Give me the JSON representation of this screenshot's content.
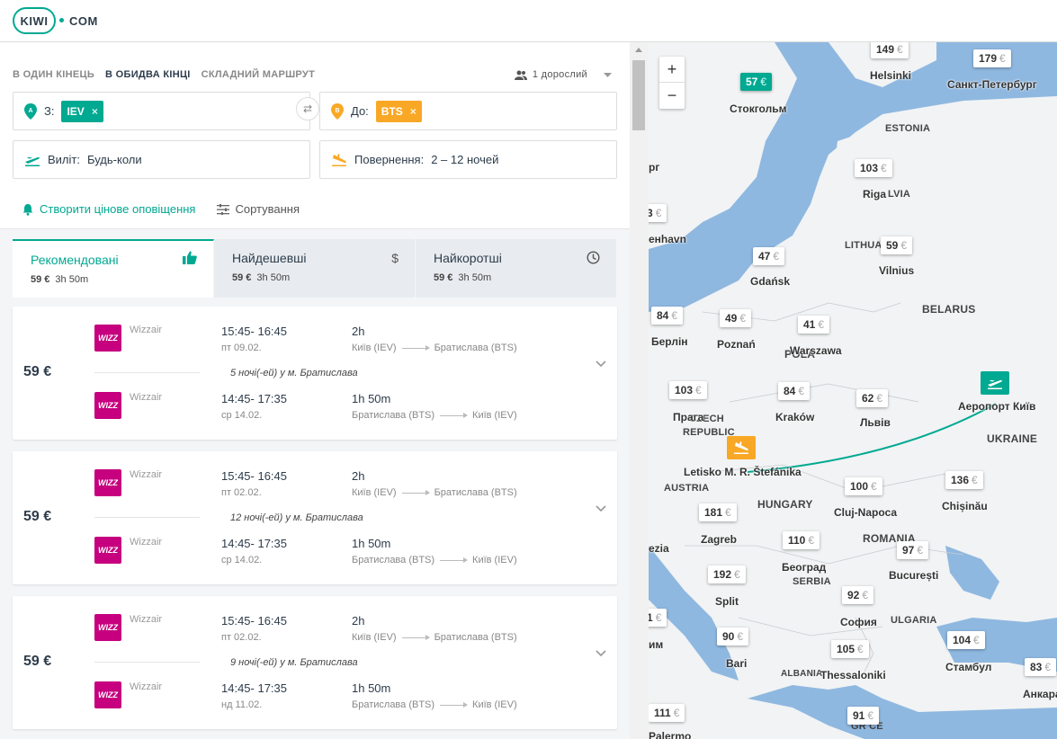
{
  "header": {
    "logo": "KIWI",
    "logo_rest": "COM"
  },
  "search": {
    "trip_types": [
      "В ОДИН КІНЕЦЬ",
      "В ОБИДВА КІНЦІ",
      "СКЛАДНИЙ МАРШРУТ"
    ],
    "passengers": "1 дорослий",
    "from_label": "З:",
    "from_value": "IEV",
    "to_label": "До:",
    "to_value": "BTS",
    "depart_label": "Виліт:",
    "depart_value": "Будь-коли",
    "return_label": "Повернення:",
    "return_value": "2 – 12 ночей",
    "chip_remove": "×",
    "swap": "⇄"
  },
  "actions": {
    "alert": "Створити цінове оповіщення",
    "sort": "Сортування"
  },
  "tabs": [
    {
      "title": "Рекомендовані",
      "price": "59 €",
      "duration": "3h 50m",
      "icon": "thumbs-up-icon"
    },
    {
      "title": "Найдешевші",
      "price": "59 €",
      "duration": "3h 50m",
      "icon": "dollar-icon"
    },
    {
      "title": "Найкоротші",
      "price": "59 €",
      "duration": "3h 50m",
      "icon": "clock-icon"
    }
  ],
  "results": [
    {
      "price": "59 €",
      "out": {
        "carrier": "Wizzair",
        "time": "15:45- 16:45",
        "date": "пт 09.02.",
        "duration": "2h",
        "from": "Київ (IEV)",
        "to": "Братислава (BTS)"
      },
      "stay": "5 ночі(-ей) у м. Братислава",
      "back": {
        "carrier": "Wizzair",
        "time": "14:45- 17:35",
        "date": "ср 14.02.",
        "duration": "1h 50m",
        "from": "Братислава (BTS)",
        "to": "Київ (IEV)"
      }
    },
    {
      "price": "59 €",
      "out": {
        "carrier": "Wizzair",
        "time": "15:45- 16:45",
        "date": "пт 02.02.",
        "duration": "2h",
        "from": "Київ (IEV)",
        "to": "Братислава (BTS)"
      },
      "stay": "12 ночі(-ей) у м. Братислава",
      "back": {
        "carrier": "Wizzair",
        "time": "14:45- 17:35",
        "date": "ср 14.02.",
        "duration": "1h 50m",
        "from": "Братислава (BTS)",
        "to": "Київ (IEV)"
      }
    },
    {
      "price": "59 €",
      "out": {
        "carrier": "Wizzair",
        "time": "15:45- 16:45",
        "date": "пт 02.02.",
        "duration": "2h",
        "from": "Київ (IEV)",
        "to": "Братислава (BTS)"
      },
      "stay": "9 ночі(-ей) у м. Братислава",
      "back": {
        "carrier": "Wizzair",
        "time": "14:45- 17:35",
        "date": "нд 11.02.",
        "duration": "1h 50m",
        "from": "Братислава (BTS)",
        "to": "Київ (IEV)"
      }
    }
  ],
  "wizz_logo": "WIZZ",
  "map": {
    "zoom_in": "+",
    "zoom_out": "−",
    "euro": "€",
    "prices": [
      "149",
      "179",
      "57",
      "103",
      "3",
      "47",
      "59",
      "84",
      "49",
      "41",
      "103",
      "84",
      "62",
      "181",
      "100",
      "136",
      "110",
      "97",
      "192",
      "92",
      "1",
      "90",
      "105",
      "104",
      "83",
      "111",
      "91"
    ],
    "cities": [
      "Helsinki",
      "Санкт-Петербург",
      "Стокгольм",
      "Riga",
      "Vilnius",
      "Gdańsk",
      "Берлін",
      "Poznań",
      "Warszawa",
      "Прага",
      "Kraków",
      "Львів",
      "Аеропорт Київ",
      "Letisko M. R. Štefánika",
      "Zagreb",
      "Cluj-Napoca",
      "Chișinău",
      "Београд",
      "București",
      "Split",
      "София",
      "Bari",
      "Thessaloniki",
      "Стамбул",
      "Анкара",
      "Palermo",
      "рг",
      "енhavn",
      "им",
      "ezia"
    ],
    "countries": [
      "ESTONIA",
      "LITHUA",
      "LVIA",
      "BELARUS",
      "POLA",
      "CZECH",
      "REPUBLIC",
      "UKRAINE",
      "AUSTRIA",
      "HUNGARY",
      "ROMANIA",
      "SERBIA",
      "ULGARIA",
      "ALBANIA",
      "GR CE"
    ],
    "colors": {
      "water": "#8fb8e0",
      "land": "#f1f3f4",
      "route": "#00a991",
      "accent": "#00a991",
      "dest": "#f9a825"
    }
  }
}
